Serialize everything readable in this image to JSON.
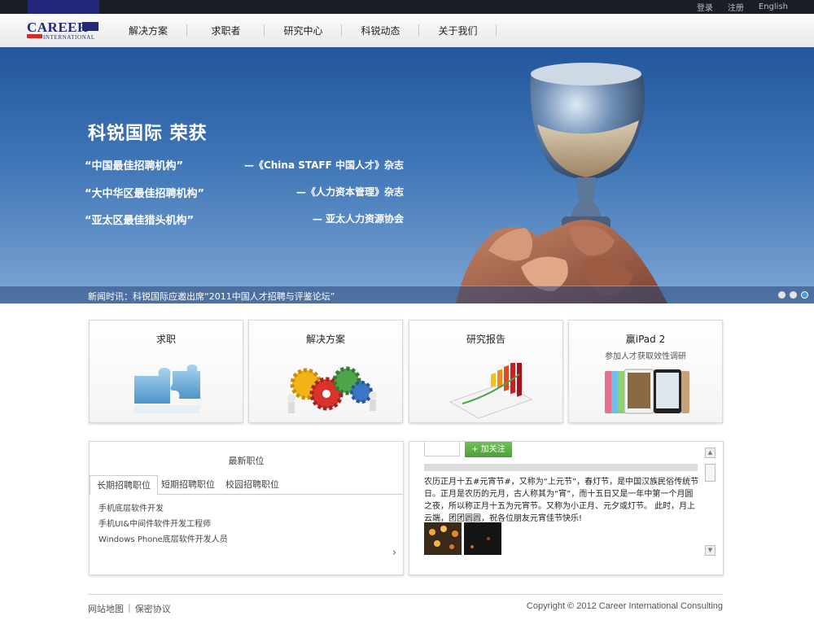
{
  "topbar": {
    "links": [
      "登录",
      "注册",
      "English"
    ]
  },
  "logo": {
    "line1": "CAREER",
    "line2": "INTERNATIONAL"
  },
  "nav": {
    "items": [
      "解决方案",
      "求职者",
      "研究中心",
      "科锐动态",
      "关于我们"
    ]
  },
  "hero": {
    "headline": "科锐国际 荣获",
    "awards": [
      {
        "award": "“中国最佳招聘机构”",
        "source": "—《China STAFF 中国人才》杂志"
      },
      {
        "award": "“大中华区最佳招聘机构”",
        "source": "—《人力资本管理》杂志"
      },
      {
        "award": "“亚太区最佳猎头机构”",
        "source": "— 亚太人力资源协会"
      }
    ],
    "news": "新闻时讯：科锐国际应邀出席“2011中国人才招聘与评鉴论坛”",
    "slides": {
      "count": 3,
      "active": 3
    }
  },
  "cards": [
    {
      "title": "求职",
      "subtitle": "",
      "icon": "puzzle-icon"
    },
    {
      "title": "解决方案",
      "subtitle": "",
      "icon": "gears-icon"
    },
    {
      "title": "研究报告",
      "subtitle": "",
      "icon": "bar-chart-icon"
    },
    {
      "title": "赢iPad 2",
      "subtitle": "参加人才获取效性调研",
      "icon": "ipad-icon"
    }
  ],
  "jobs": {
    "title": "最新职位",
    "tabs": [
      "长期招聘职位",
      "短期招聘职位",
      "校园招聘职位"
    ],
    "active_tab": 0,
    "list": [
      "手机底层软件开发",
      "手机UI&中间件软件开发工程师",
      "Windows Phone底层软件开发人员"
    ]
  },
  "weibo": {
    "follow_label": "+ 加关注",
    "post": "农历正月十五#元宵节#，又称为“上元节”，春灯节，是中国汉族民俗传统节日。正月是农历的元月，古人称其为“宵”，而十五日又是一年中第一个月圆之夜，所以称正月十五为元宵节。又称为小正月、元夕或灯节。 此时，月上云端，团团圆圆，祝各位朋友元宵佳节快乐!"
  },
  "footer": {
    "links": [
      "网站地图",
      "保密协议"
    ],
    "copyright": "Copyright © 2012 Career International Consulting"
  },
  "colors": {
    "brand_blue": "#23287a",
    "brand_red": "#d42a26",
    "sky": "#3f76b7",
    "follow_green": "#5bb046"
  }
}
